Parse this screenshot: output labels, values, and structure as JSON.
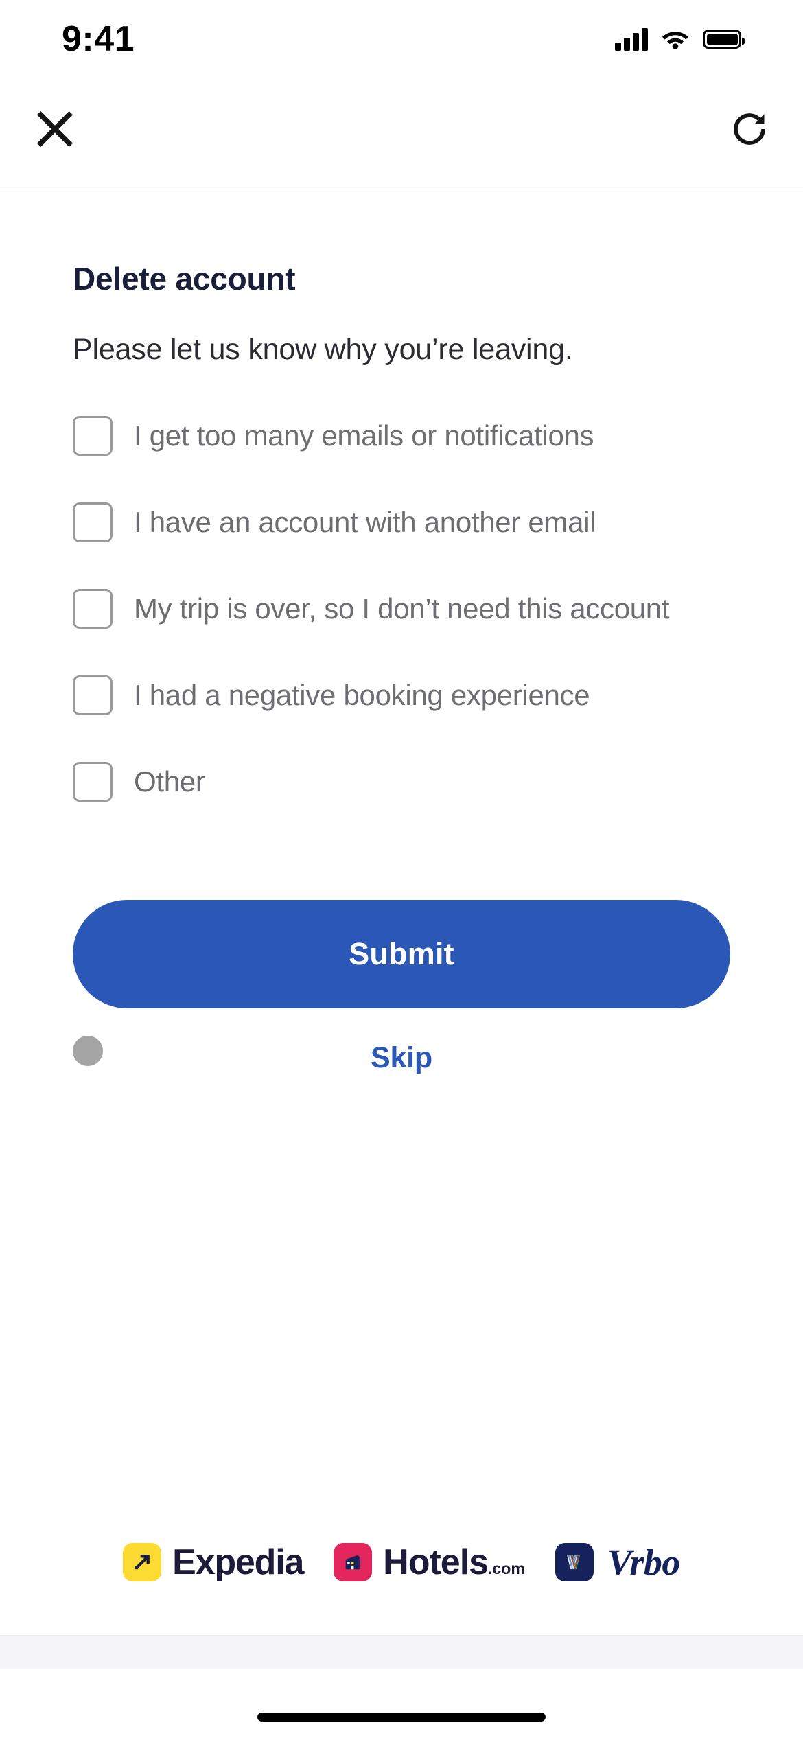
{
  "status_bar": {
    "time": "9:41",
    "signal_icon": "cellular-signal-icon",
    "wifi_icon": "wifi-icon",
    "battery_icon": "battery-full-icon"
  },
  "navbar": {
    "close_icon": "close-icon",
    "refresh_icon": "refresh-icon"
  },
  "main": {
    "title": "Delete account",
    "subtitle": "Please let us know why you’re leaving.",
    "options": [
      {
        "label": "I get too many emails or notifications",
        "checked": false
      },
      {
        "label": "I have an account with another email",
        "checked": false
      },
      {
        "label": "My trip is over, so I don’t need this account",
        "checked": false
      },
      {
        "label": "I had a negative booking experience",
        "checked": false
      },
      {
        "label": "Other",
        "checked": false
      }
    ],
    "submit_label": "Submit",
    "skip_label": "Skip"
  },
  "footer": {
    "brands": [
      {
        "name": "Expedia",
        "word": "Expedia",
        "tld": "",
        "tile_color": "#fddb32"
      },
      {
        "name": "Hotels.com",
        "word": "Hotels",
        "tld": ".com",
        "tile_color": "#e2255a"
      },
      {
        "name": "Vrbo",
        "word": "Vrbo",
        "tld": "",
        "tile_color": "#16225c"
      }
    ]
  },
  "colors": {
    "accent_blue": "#2b58b7",
    "text_dark": "#191e3b",
    "text_muted": "#6d6d73",
    "checkbox_border": "#9a9a9e",
    "dot_gray": "#a5a5a5"
  }
}
